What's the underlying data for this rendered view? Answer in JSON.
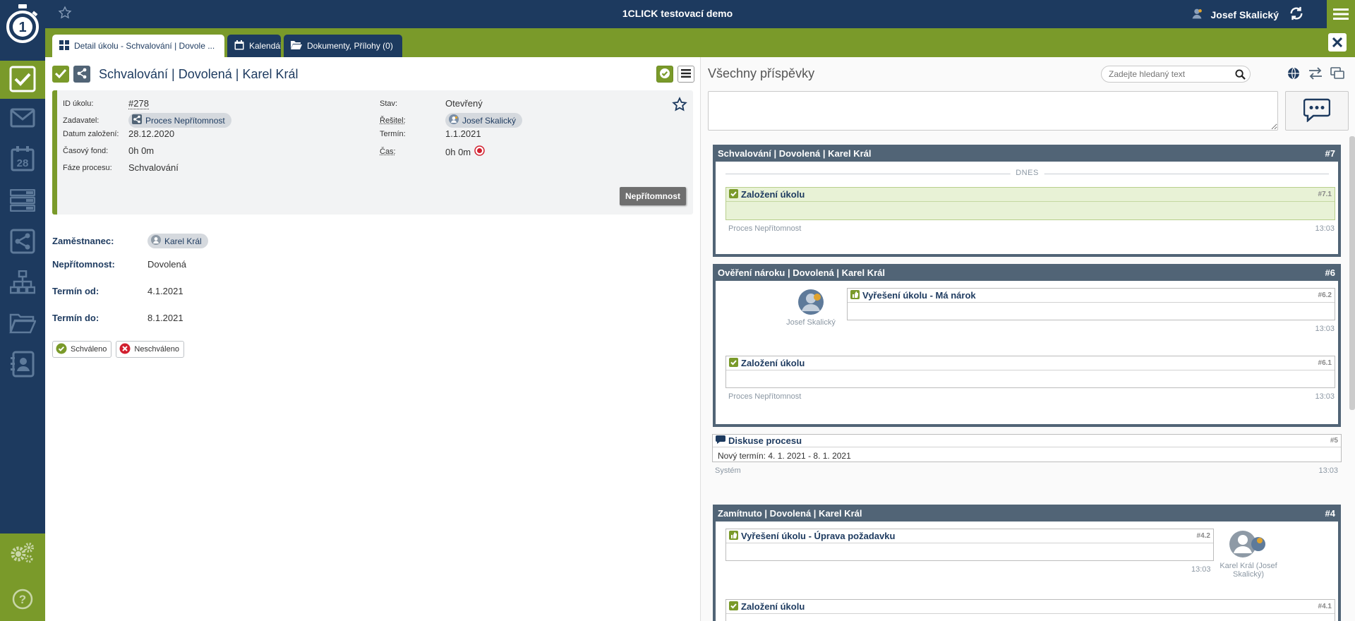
{
  "app": {
    "title": "1CLICK testovací demo",
    "user_name": "Josef Skalický"
  },
  "tabs": [
    {
      "label": "Detail úkolu - Schvalování | Dovole ..."
    },
    {
      "label": "Kalendář"
    },
    {
      "label": "Dokumenty, Přílohy (0)"
    }
  ],
  "task": {
    "title": "Schvalování | Dovolená | Karel Král",
    "info": {
      "id_label": "ID úkolu:",
      "id_value": "#278",
      "requester_label": "Zadavatel:",
      "requester_value": "Proces Nepřítomnost",
      "created_label": "Datum založení:",
      "created_value": "28.12.2020",
      "fund_label": "Časový fond:",
      "fund_value": "0h 0m",
      "phase_label": "Fáze procesu:",
      "phase_value": "Schvalování",
      "state_label": "Stav:",
      "state_value": "Otevřený",
      "solver_label": "Řešitel:",
      "solver_value": "Josef Skalický",
      "term_label": "Termín:",
      "term_value": "1.1.2021",
      "time_label": "Čas:",
      "time_value": "0h 0m"
    },
    "absence_button": "Nepřítomnost",
    "fields": [
      {
        "label": "Zaměstnanec:",
        "value": "Karel Král"
      },
      {
        "label": "Nepřítomnost:",
        "value": "Dovolená"
      },
      {
        "label": "Termín od:",
        "value": "4.1.2021"
      },
      {
        "label": "Termín do:",
        "value": "8.1.2021"
      }
    ],
    "approve_label": "Schváleno",
    "reject_label": "Neschváleno"
  },
  "posts": {
    "title": "Všechny příspěvky",
    "search_placeholder": "Zadejte hledaný text",
    "groups": [
      {
        "title": "Schvalování | Dovolená | Karel Král",
        "number": "#7",
        "today_label": "DNES",
        "items": [
          {
            "title": "Založení úkolu",
            "number": "#7.1",
            "meta": "Proces Nepřítomnost",
            "time": "13:03"
          }
        ]
      },
      {
        "title": "Ověření nároku | Dovolená | Karel Král",
        "number": "#6",
        "author": "Josef Skalický",
        "items": [
          {
            "title": "Vyřešení úkolu - Má nárok",
            "number": "#6.2",
            "time": "13:03"
          },
          {
            "title": "Založení úkolu",
            "number": "#6.1",
            "meta": "Proces Nepřítomnost",
            "time": "13:03"
          }
        ]
      },
      {
        "title": "Zamítnuto | Dovolená | Karel Král",
        "number": "#4",
        "author": "Karel Král (Josef Skalický)",
        "items": [
          {
            "title": "Vyřešení úkolu - Úprava požadavku",
            "number": "#4.2",
            "time": "13:03"
          },
          {
            "title": "Založení úkolu",
            "number": "#4.1"
          }
        ]
      }
    ],
    "discussion": {
      "title": "Diskuse procesu",
      "number": "#5",
      "body": "Nový termín: 4. 1. 2021 - 8. 1. 2021",
      "meta": "Systém",
      "time": "13:03"
    }
  },
  "colors": {
    "navy": "#1d3a5f",
    "green": "#7a9a2a",
    "slate": "#516476",
    "red": "#d11f2e"
  }
}
